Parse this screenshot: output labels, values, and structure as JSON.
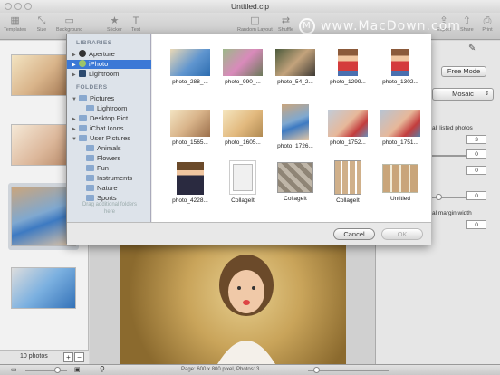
{
  "window": {
    "title": "Untitled.cip",
    "watermark": "www.MacDown.com"
  },
  "toolbar": {
    "items": [
      "Templates",
      "Size",
      "Background",
      "Sticker",
      "Text",
      "Random Layout",
      "Shuffle",
      "Export",
      "Share",
      "Print"
    ]
  },
  "photo_strip": {
    "count_label": "10 photos",
    "add_label": "+",
    "remove_label": "−"
  },
  "inspector": {
    "free_mode_label": "Free Mode",
    "layout_select": "Mosaic",
    "all_listed_label": "all listed photos",
    "margin_label": "al margin width",
    "stepper_values": [
      "3",
      "0",
      "0",
      "0",
      "0"
    ]
  },
  "statusbar": {
    "text": "Page: 600 x 800 pixel, Photos: 3"
  },
  "media_browser": {
    "libraries_header": "LIBRARIES",
    "folders_header": "FOLDERS",
    "libraries": [
      {
        "label": "Aperture",
        "selected": false
      },
      {
        "label": "iPhoto",
        "selected": true
      },
      {
        "label": "Lightroom",
        "selected": false
      }
    ],
    "folders": [
      {
        "label": "Pictures",
        "indent": 0,
        "expanded": true
      },
      {
        "label": "Lightroom",
        "indent": 1,
        "expanded": false
      },
      {
        "label": "Desktop Pict...",
        "indent": 0,
        "expanded": false
      },
      {
        "label": "iChat Icons",
        "indent": 0,
        "expanded": false
      },
      {
        "label": "User Pictures",
        "indent": 0,
        "expanded": true
      },
      {
        "label": "Animals",
        "indent": 1,
        "expanded": false
      },
      {
        "label": "Flowers",
        "indent": 1,
        "expanded": false
      },
      {
        "label": "Fun",
        "indent": 1,
        "expanded": false
      },
      {
        "label": "Instruments",
        "indent": 1,
        "expanded": false
      },
      {
        "label": "Nature",
        "indent": 1,
        "expanded": false
      },
      {
        "label": "Sports",
        "indent": 1,
        "expanded": false
      }
    ],
    "drag_hint": "Drag additional folders here",
    "photos": [
      {
        "caption": "photo_288_..."
      },
      {
        "caption": "photo_990_..."
      },
      {
        "caption": "photo_54_2..."
      },
      {
        "caption": "photo_1299..."
      },
      {
        "caption": "photo_1302..."
      },
      {
        "caption": "photo_1565..."
      },
      {
        "caption": "photo_1605..."
      },
      {
        "caption": "photo_1726..."
      },
      {
        "caption": "photo_1752..."
      },
      {
        "caption": "photo_1751..."
      },
      {
        "caption": "photo_4228..."
      },
      {
        "caption": "CollageIt"
      },
      {
        "caption": "CollageIt"
      },
      {
        "caption": "CollageIt"
      },
      {
        "caption": "Untitled"
      }
    ],
    "cancel_label": "Cancel",
    "ok_label": "OK"
  }
}
